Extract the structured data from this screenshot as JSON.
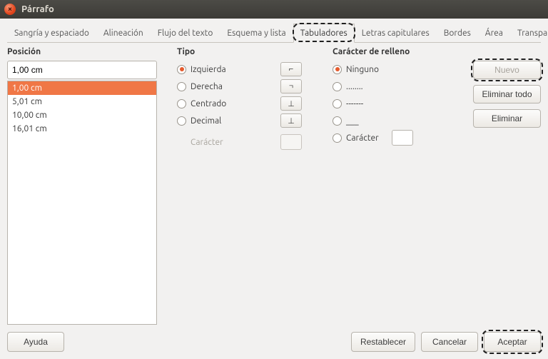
{
  "window": {
    "title": "Párrafo"
  },
  "tabs": {
    "sangria": "Sangría y espaciado",
    "alineacion": "Alineación",
    "flujo": "Flujo del texto",
    "esquema": "Esquema y lista",
    "tabuladores": "Tabuladores",
    "capitulares": "Letras capitulares",
    "bordes": "Bordes",
    "area": "Área",
    "transparencia": "Transparencia"
  },
  "position": {
    "heading": "Posición",
    "input_value": "1,00 cm",
    "items": [
      "1,00 cm",
      "5,01 cm",
      "10,00 cm",
      "16,01 cm"
    ],
    "selected_index": 0
  },
  "tipo": {
    "heading": "Tipo",
    "izquierda": "Izquierda",
    "derecha": "Derecha",
    "centrado": "Centrado",
    "decimal": "Decimal",
    "caracter": "Carácter",
    "glyph_left": "⌐",
    "glyph_right": "¬",
    "glyph_center": "⊥",
    "glyph_decimal": "⊥"
  },
  "fill": {
    "heading": "Carácter de relleno",
    "ninguno": "Ninguno",
    "dots": "........",
    "dashes": "-------",
    "under": "___",
    "caracter": "Carácter"
  },
  "buttons": {
    "nuevo": "Nuevo",
    "eliminar_todo": "Eliminar todo",
    "eliminar": "Eliminar"
  },
  "footer": {
    "ayuda": "Ayuda",
    "restablecer": "Restablecer",
    "cancelar": "Cancelar",
    "aceptar": "Aceptar"
  }
}
